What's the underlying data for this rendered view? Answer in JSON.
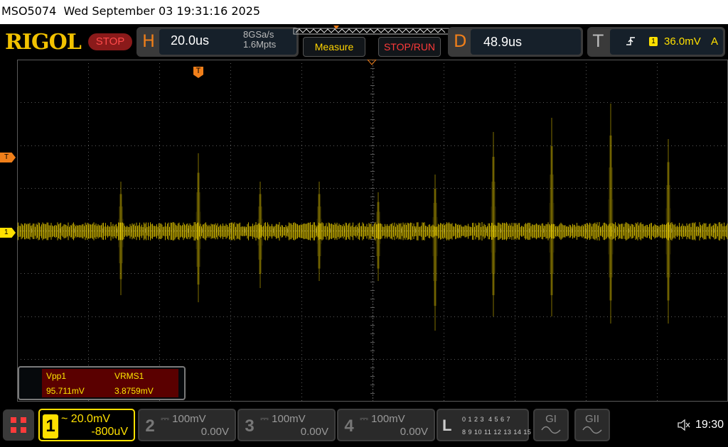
{
  "title_bar": {
    "text": "MSO5074  Wed September 03 19:31:16 2025"
  },
  "brand": {
    "logo": "RIGOL",
    "run_state": "STOP"
  },
  "horizontal": {
    "letter": "H",
    "timebase": "20.0us",
    "sample_rate": "8GSa/s",
    "memory_depth": "1.6Mpts"
  },
  "buttons": {
    "measure": "Measure",
    "stop_run": "STOP/RUN"
  },
  "delay": {
    "letter": "D",
    "value": "48.9us"
  },
  "trigger": {
    "letter": "T",
    "slope_icon": "rising-edge-icon",
    "source": "1",
    "level": "36.0mV",
    "mode": "A"
  },
  "markers": {
    "trigger_level": "T",
    "channel1": "1",
    "trigger_pos": "T"
  },
  "measurements": [
    {
      "name": "Vpp1",
      "value": "95.711mV"
    },
    {
      "name": "VRMS1",
      "value": "3.8759mV"
    }
  ],
  "channels": [
    {
      "num": "1",
      "coupling_icon": "ac-coupling-icon",
      "coupling": "~",
      "scale": "20.0mV",
      "offset": "-800uV",
      "active": true
    },
    {
      "num": "2",
      "coupling_icon": "dc-coupling-icon",
      "coupling": "⎓",
      "scale": "100mV",
      "offset": "0.00V",
      "active": false
    },
    {
      "num": "3",
      "coupling_icon": "dc-coupling-icon",
      "coupling": "⎓",
      "scale": "100mV",
      "offset": "0.00V",
      "active": false
    },
    {
      "num": "4",
      "coupling_icon": "dc-coupling-icon",
      "coupling": "⎓",
      "scale": "100mV",
      "offset": "0.00V",
      "active": false
    }
  ],
  "logic": {
    "letter": "L",
    "row1": "0 1 2 3  4 5 6 7",
    "row2": "8 9 10 11 12 13 14 15"
  },
  "generators": [
    {
      "label": "GI"
    },
    {
      "label": "GII"
    }
  ],
  "status": {
    "clock": "19:30",
    "speaker_icon": "speaker-muted-icon"
  },
  "colors": {
    "ch1": "#ffe000",
    "trigger": "#f07f1a",
    "stop": "#ff3a3a",
    "grid": "#5a5a5a"
  }
}
